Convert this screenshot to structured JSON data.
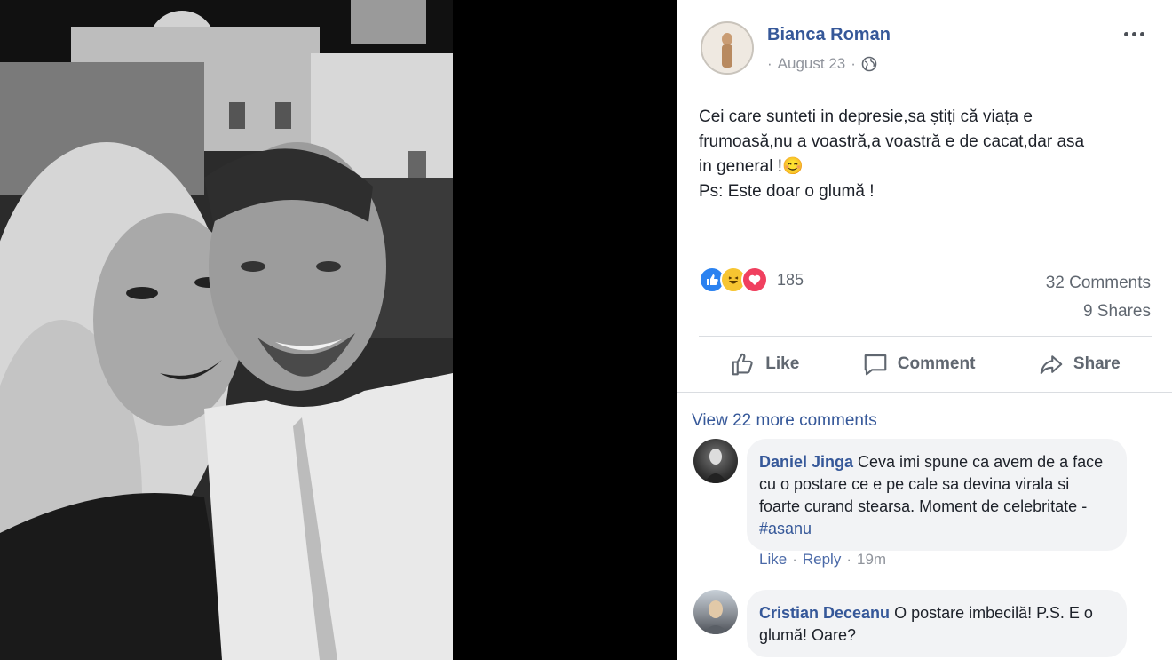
{
  "post": {
    "author": "Bianca Roman",
    "date": "August 23",
    "separator": "·",
    "text": "Cei care sunteti in depresie,sa știți că viața e\nfrumoasă,nu a voastră,a voastră e de cacat,dar asa\nin general !😊\nPs: Este doar o glumă !"
  },
  "reactions": {
    "icons": [
      "like-icon",
      "haha-icon",
      "love-icon"
    ],
    "count": "185",
    "comments": "32 Comments",
    "shares": "9 Shares"
  },
  "actions": {
    "like": "Like",
    "comment": "Comment",
    "share": "Share"
  },
  "comments": {
    "view_more": "View 22 more comments",
    "items": [
      {
        "name": "Daniel Jinga",
        "text": " Ceva imi spune ca avem de a face cu o postare ce e pe cale sa devina virala si foarte curand stearsa. Moment de celebritate - ",
        "tag": "#asanu",
        "like": "Like",
        "dot": "·",
        "reply": "Reply",
        "time": "19m"
      },
      {
        "name": "Cristian Deceanu",
        "text": " O postare imbecilă! P.S. E o glumă! Oare?"
      }
    ]
  },
  "colors": {
    "link": "#365899",
    "text": "#1d2129",
    "muted": "#90949c",
    "like_blue": "#2b82f0",
    "haha_yellow": "#f7c531",
    "love_red": "#f0405f"
  }
}
